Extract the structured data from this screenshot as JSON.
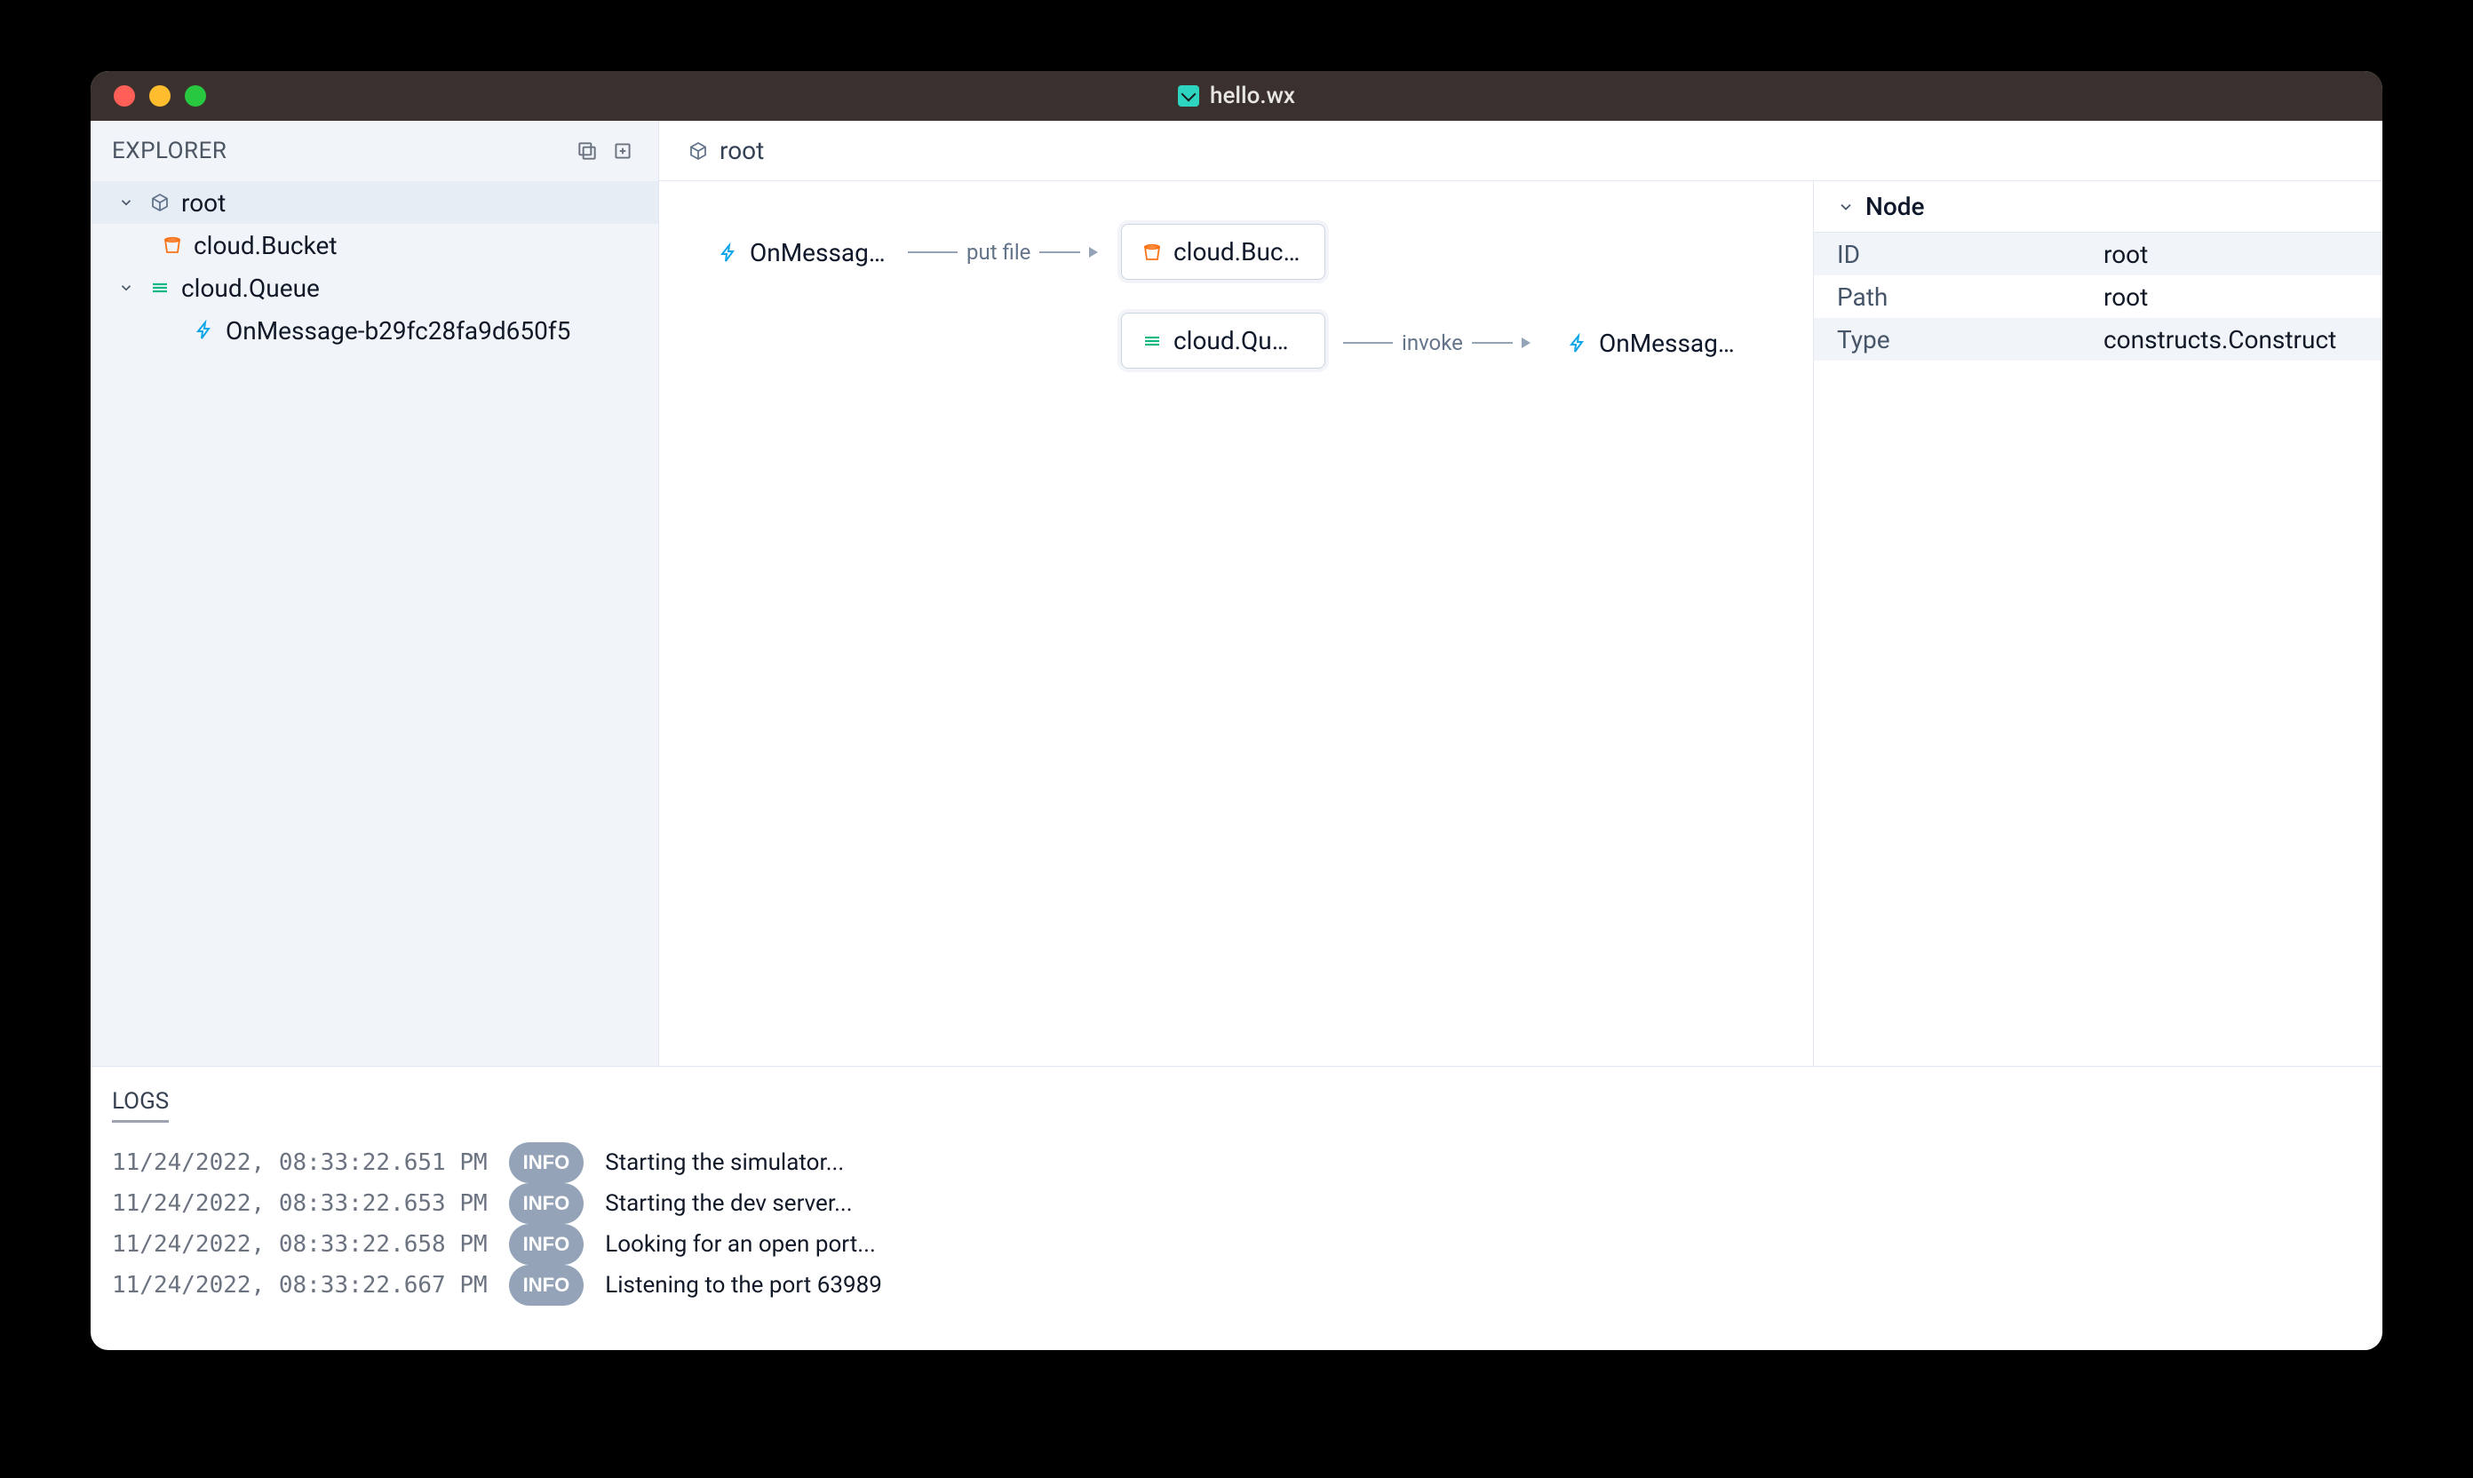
{
  "window": {
    "title": "hello.wx"
  },
  "sidebar": {
    "title": "EXPLORER",
    "tree": {
      "root": "root",
      "bucket": "cloud.Bucket",
      "queue": "cloud.Queue",
      "onmessage": "OnMessage-b29fc28fa9d650f5"
    }
  },
  "breadcrumb": {
    "root": "root"
  },
  "canvas": {
    "nodes": {
      "onmessage_left": "OnMessag…",
      "bucket": "cloud.Buc…",
      "queue": "cloud.Qu…",
      "onmessage_right": "OnMessag…"
    },
    "edges": {
      "putfile": "put file",
      "invoke": "invoke"
    }
  },
  "details": {
    "title": "Node",
    "rows": [
      {
        "key": "ID",
        "value": "root"
      },
      {
        "key": "Path",
        "value": "root"
      },
      {
        "key": "Type",
        "value": "constructs.Construct"
      }
    ]
  },
  "logs": {
    "title": "LOGS",
    "entries": [
      {
        "ts": "11/24/2022, 08:33:22.651 PM",
        "level": "INFO",
        "msg": "Starting the simulator..."
      },
      {
        "ts": "11/24/2022, 08:33:22.653 PM",
        "level": "INFO",
        "msg": "Starting the dev server..."
      },
      {
        "ts": "11/24/2022, 08:33:22.658 PM",
        "level": "INFO",
        "msg": "Looking for an open port..."
      },
      {
        "ts": "11/24/2022, 08:33:22.667 PM",
        "level": "INFO",
        "msg": "Listening to the port 63989"
      }
    ]
  },
  "icons": {
    "collapse_all": "collapse",
    "expand_all": "expand"
  }
}
